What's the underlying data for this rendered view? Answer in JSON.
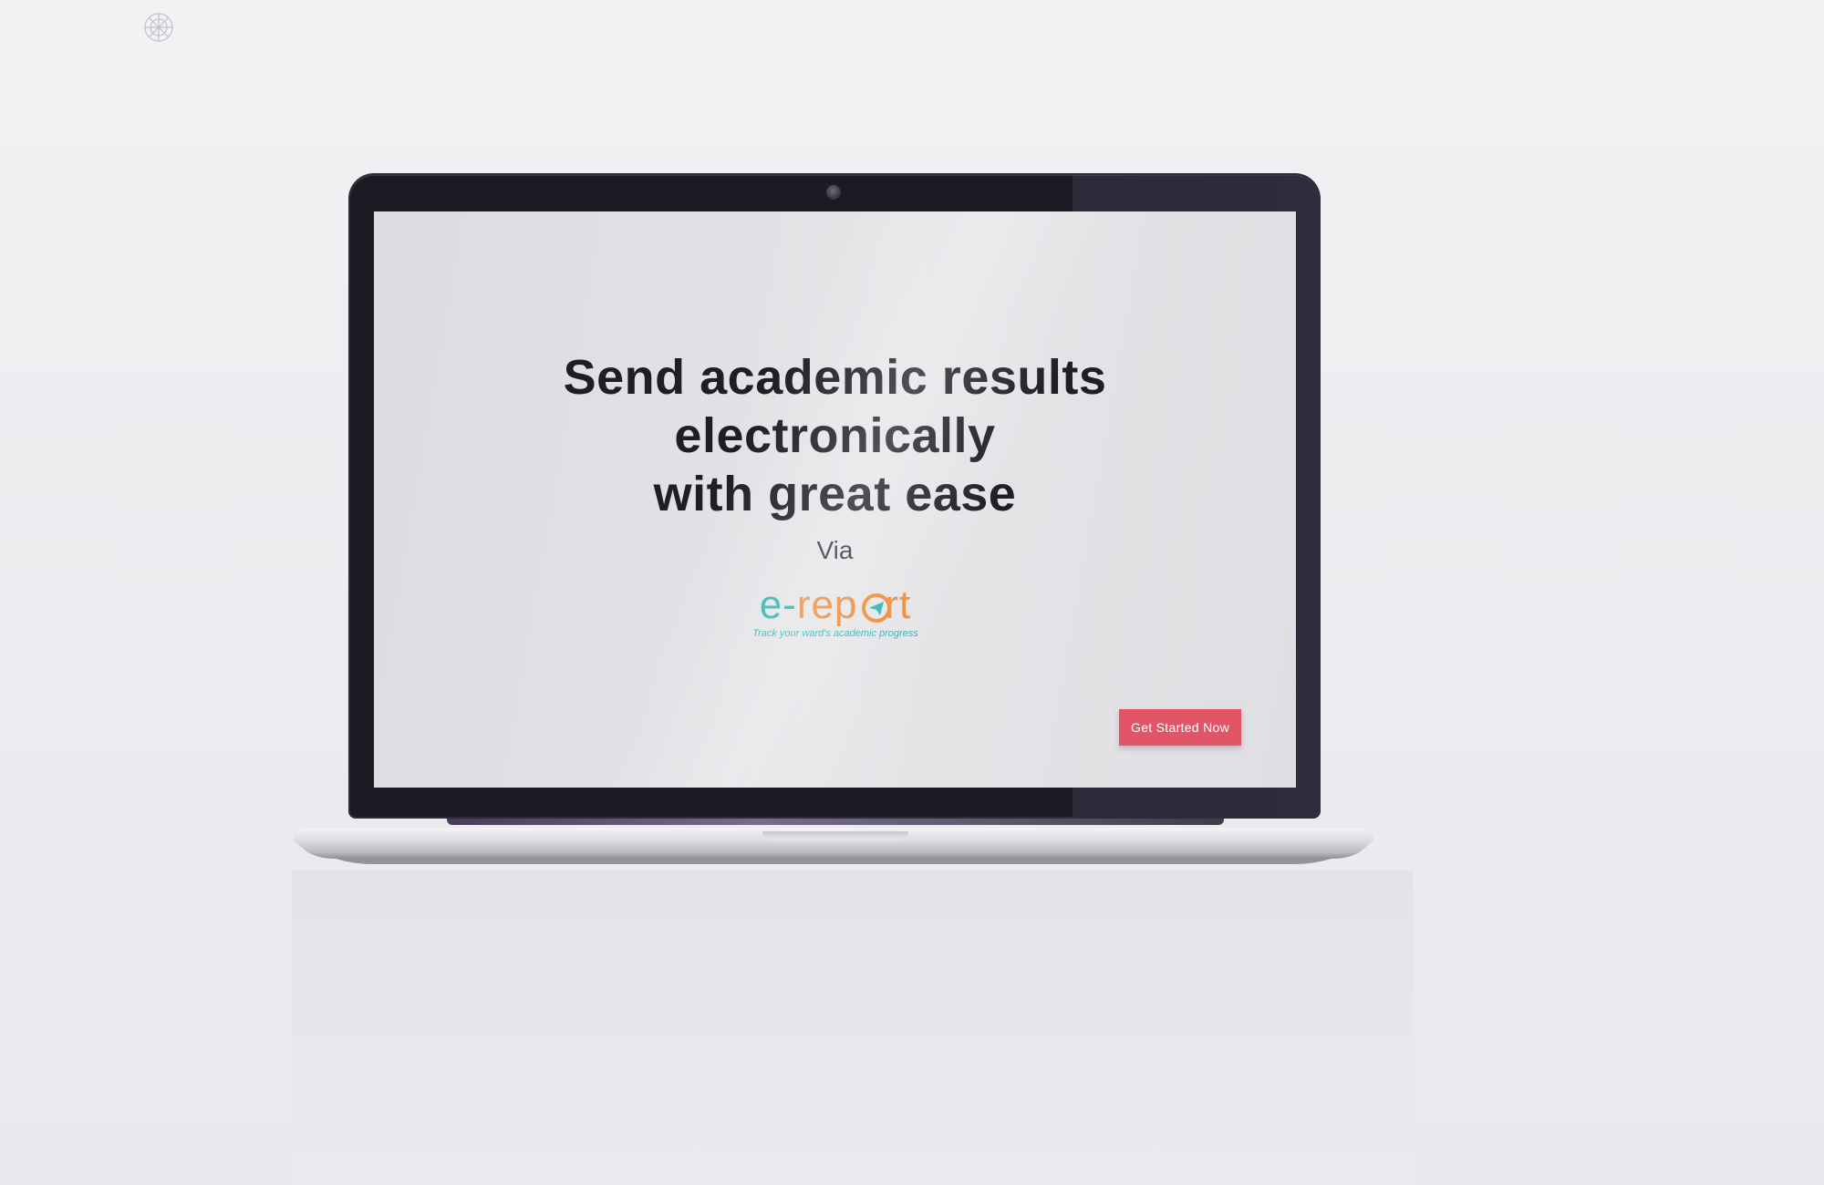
{
  "screen": {
    "headline_lines": [
      "Send academic results",
      "electronically",
      "with great ease"
    ],
    "via": "Via",
    "logo": {
      "word_prefix": "e-",
      "word_body": "rep",
      "word_suffix": "rt",
      "tagline": "Track your ward's academic progress"
    },
    "cta_label": "Get Started Now"
  },
  "colors": {
    "headline": "#1e1e26",
    "logo_teal": "#2bb4b4",
    "logo_orange": "#ef8b37",
    "cta_bg": "#e15567",
    "bezel": "#1b1b24"
  },
  "icons": [
    "brand-mark-icon",
    "webcam-icon",
    "paper-plane-icon"
  ]
}
